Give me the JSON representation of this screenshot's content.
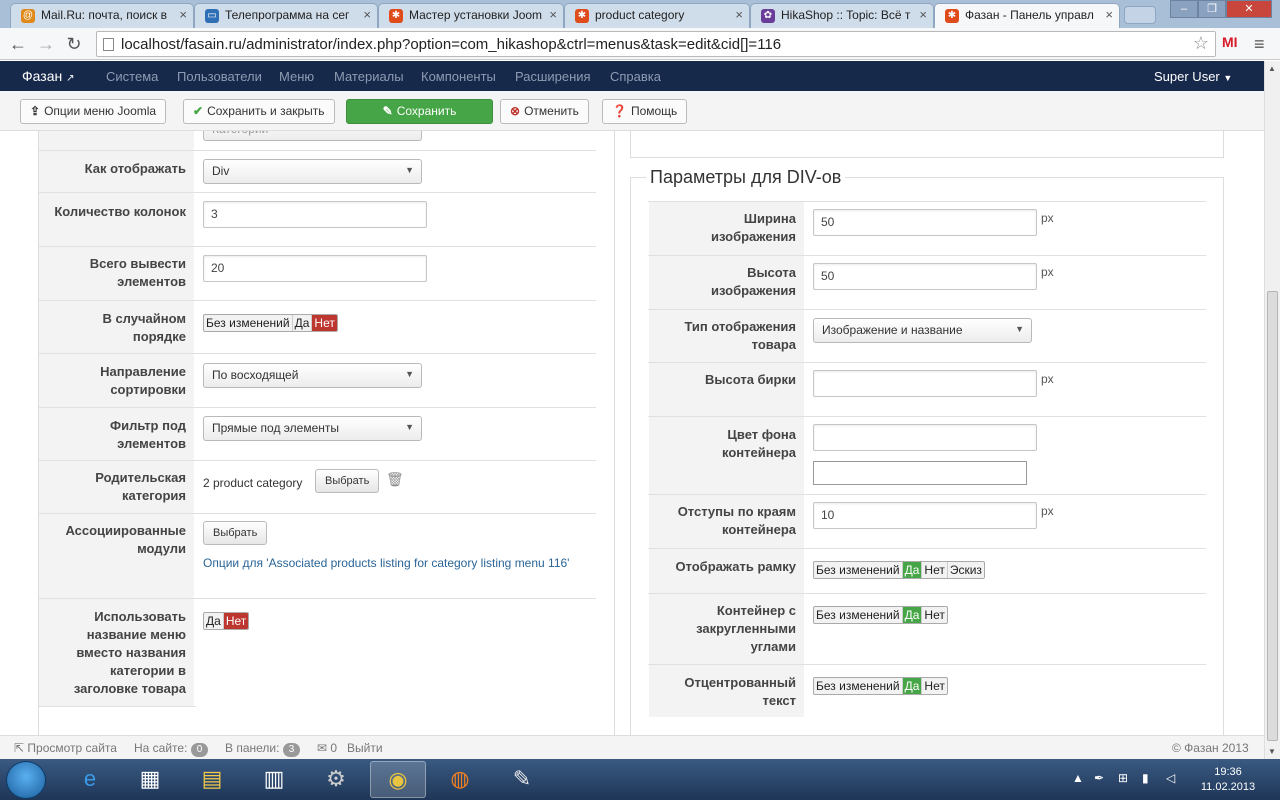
{
  "browser": {
    "tabs": [
      {
        "title": "Mail.Ru: почта, поиск в",
        "color": "#e08a1c"
      },
      {
        "title": "Телепрограмма на сег",
        "color": "#2f6fb5"
      },
      {
        "title": "Мастер установки Joom",
        "color": "#e04b1c"
      },
      {
        "title": "product category",
        "color": "#e04b1c"
      },
      {
        "title": "HikaShop :: Topic: Всё т",
        "color": "#6a3d9a"
      },
      {
        "title": "Фазан - Панель управл",
        "color": "#e04b1c"
      }
    ],
    "url": "localhost/fasain.ru/administrator/index.php?option=com_hikashop&ctrl=menus&task=edit&cid[]=116",
    "extension_label": "MI"
  },
  "nav": {
    "brand": "Фазан",
    "items": [
      "Система",
      "Пользователи",
      "Меню",
      "Материалы",
      "Компоненты",
      "Расширения",
      "Справка"
    ],
    "user": "Super User"
  },
  "toolbar": {
    "joomla_options": "Опции меню Joomla",
    "save_close": "Сохранить и закрыть",
    "save": "Сохранить",
    "cancel": "Отменить",
    "help": "Помощь"
  },
  "left": {
    "cut_value": "Категории",
    "display_label": "Как отображать",
    "display_value": "Div",
    "columns_label": "Количество колонок",
    "columns_value": "3",
    "total_label": "Всего вывести элементов",
    "total_value": "20",
    "random_label": "В случайном порядке",
    "random_options": [
      "Без изменений",
      "Да",
      "Нет"
    ],
    "order_label": "Направление сортировки",
    "order_value": "По восходящей",
    "filter_label": "Фильтр под элементов",
    "filter_value": "Прямые под элементы",
    "parent_label": "Родительская категория",
    "parent_value": "2 product category",
    "select_btn": "Выбрать",
    "modules_label": "Ассоциированные модули",
    "modules_btn": "Выбрать",
    "modules_link": "Опции для 'Associated products listing for category listing menu 116'",
    "use_name_label": "Использовать название меню вместо названия категории в заголовке товара",
    "use_name_options": [
      "Да",
      "Нет"
    ]
  },
  "right": {
    "legend": "Параметры для DIV-ов",
    "unit": "px",
    "img_width_label": "Ширина изображения",
    "img_width_value": "50",
    "img_height_label": "Высота изображения",
    "img_height_value": "50",
    "display_type_label": "Тип отображения товара",
    "display_type_value": "Изображение и название",
    "tag_height_label": "Высота бирки",
    "tag_height_value": "",
    "bg_color_label": "Цвет фона контейнера",
    "bg_color_value": "",
    "padding_label": "Отступы по краям контейнера",
    "padding_value": "10",
    "border_label": "Отображать рамку",
    "border_options": [
      "Без изменений",
      "Да",
      "Нет",
      "Эскиз"
    ],
    "rounded_label": "Контейнер с закругленными углами",
    "rounded_options": [
      "Без изменений",
      "Да",
      "Нет"
    ],
    "centered_label": "Отцентрованный текст",
    "centered_options": [
      "Без изменений",
      "Да",
      "Нет"
    ]
  },
  "status": {
    "view_site": "Просмотр сайта",
    "on_site": "На сайте:",
    "on_site_count": "0",
    "in_panel": "В панели:",
    "in_panel_count": "3",
    "messages_count": "0",
    "logout": "Выйти",
    "copyright": "© Фазан 2013"
  },
  "taskbar": {
    "time": "19:36",
    "date": "11.02.2013"
  },
  "colors": {
    "nav_bg": "#17294b",
    "save_green": "#46a546",
    "no_red": "#bd362f",
    "link_blue": "#2a6496"
  }
}
